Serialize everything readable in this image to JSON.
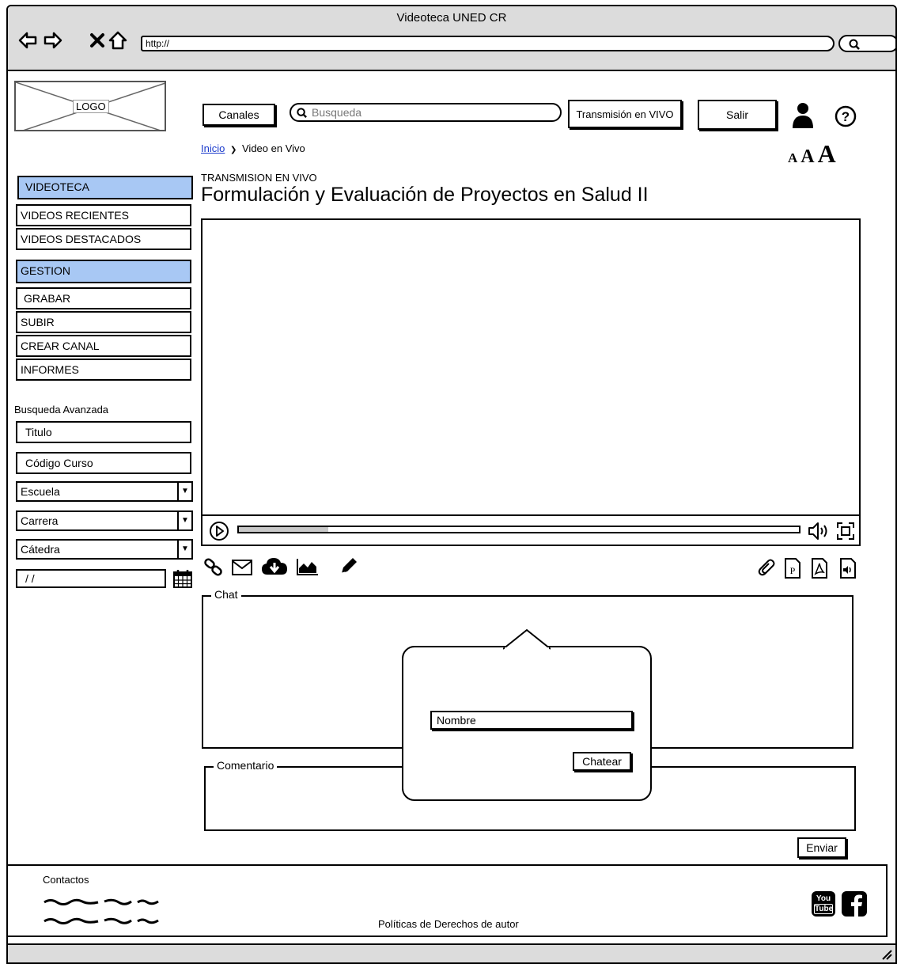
{
  "browser": {
    "title": "Videoteca UNED CR",
    "url": "http://"
  },
  "header": {
    "logo": "LOGO",
    "channels_button": "Canales",
    "search_placeholder": "Busqueda",
    "live_button": "Transmisión en VIVO",
    "logout_button": "Salir",
    "font_sizes": [
      "A",
      "A",
      "A"
    ]
  },
  "breadcrumb": {
    "home": "Inicio",
    "separator": "❯",
    "current": "Video en Vivo"
  },
  "sidebar": {
    "section1": "VIDEOTECA",
    "items1": [
      "VIDEOS RECIENTES",
      "VIDEOS DESTACADOS"
    ],
    "section2": "GESTION",
    "items2": [
      "GRABAR",
      "SUBIR",
      "CREAR CANAL",
      "INFORMES"
    ]
  },
  "advanced_search": {
    "title": "Busqueda Avanzada",
    "title_field": "Titulo",
    "course_code_field": "Código Curso",
    "school_select": "Escuela",
    "career_select": "Carrera",
    "chair_select": "Cátedra",
    "date_field": "/ /"
  },
  "main": {
    "section_label": "TRANSMISION EN VIVO",
    "video_title": "Formulación y Evaluación de Proyectos en Salud II",
    "progress": 0.16,
    "chat_legend": "Chat",
    "comment_legend": "Comentario",
    "send_button": "Enviar"
  },
  "popup": {
    "name_field": "Nombre",
    "chat_button": "Chatear"
  },
  "footer": {
    "contacts": "Contactos",
    "copyright": "Políticas de Derechos de autor",
    "youtube_label_top": "You",
    "youtube_label_bottom": "Tube"
  }
}
